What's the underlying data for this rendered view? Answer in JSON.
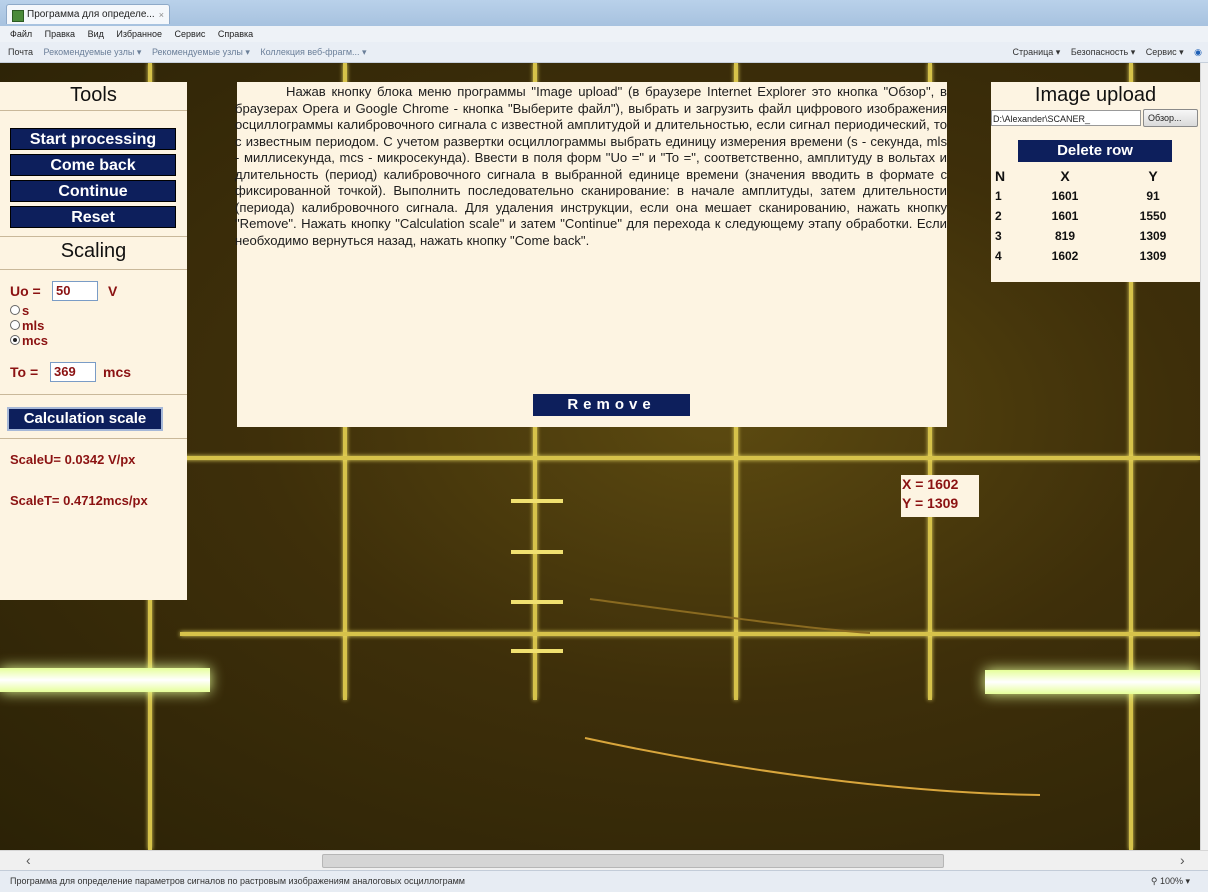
{
  "browser": {
    "tab_title": "Программа для определе...",
    "tab_close": "×",
    "menu": [
      "Файл",
      "Правка",
      "Вид",
      "Избранное",
      "Сервис",
      "Справка"
    ],
    "favorites": [
      "Почта",
      "Рекомендуемые узлы ▾",
      "Рекомендуемые узлы ▾",
      "Коллекция веб-фрагм... ▾"
    ],
    "command_bar": [
      "Страница ▾",
      "Безопасность ▾",
      "Сервис ▾"
    ],
    "status_text": "Программа для определение параметров сигналов по растровым изображениям аналоговых осциллограмм",
    "zoom": "100%"
  },
  "tools": {
    "title": "Tools",
    "start_processing": "Start processing",
    "come_back": "Come back",
    "continue": "Continue",
    "reset": "Reset",
    "scaling_title": "Scaling",
    "uo_label": "Uo =",
    "uo_value": "50",
    "uo_unit": "V",
    "radio_s": "s",
    "radio_mls": "mls",
    "radio_mcs": "mcs",
    "radio_selected": "mcs",
    "to_label": "To =",
    "to_value": "369",
    "to_unit": "mcs",
    "calc_scale": "Calculation scale",
    "scale_u": "ScaleU= 0.0342 V/px",
    "scale_t": "ScaleT= 0.4712mcs/px"
  },
  "instructions": {
    "text": "Нажав кнопку блока меню программы \"Image upload\" (в браузере Internet Explorer это кнопка \"Обзор\", в браузерах Opera и Google Chrome - кнопка \"Выберите файл\"), выбрать и загрузить файл цифрового изображения осциллограммы калибровочного сигнала с известной амплитудой и длительностью, если сигнал периодический, то с известным периодом. С учетом развертки осциллограммы выбрать единицу измерения времени (s - секунда, mls - миллисекунда, mcs - микросекунда). Ввести в поля форм \"Uo =\" и \"To =\", соответственно, амплитуду в вольтах и длительность (период) калибровочного сигнала в выбранной единице времени (значения вводить в формате с фиксированной точкой). Выполнить последовательно сканирование: в начале амплитуды, затем длительности (периода) калибровочного сигнала. Для удаления инструкции, если она мешает сканированию, нажать кнопку \"Remove\". Нажать кнопку \"Calculation scale\" и затем \"Continue\" для перехода к следующему этапу обработки. Если необходимо вернуться назад, нажать кнопку \"Come back\".",
    "remove": "Remove"
  },
  "cursor": {
    "x": "X = 1602",
    "y": "Y = 1309"
  },
  "upload": {
    "title": "Image upload",
    "file_path": "D:\\Alexander\\SCANER_",
    "browse": "Обзор...",
    "delete_row": "Delete row",
    "headers": [
      "N",
      "X",
      "Y"
    ],
    "rows": [
      [
        "1",
        "1601",
        "91"
      ],
      [
        "2",
        "1601",
        "1550"
      ],
      [
        "3",
        "819",
        "1309"
      ],
      [
        "4",
        "1602",
        "1309"
      ]
    ]
  }
}
